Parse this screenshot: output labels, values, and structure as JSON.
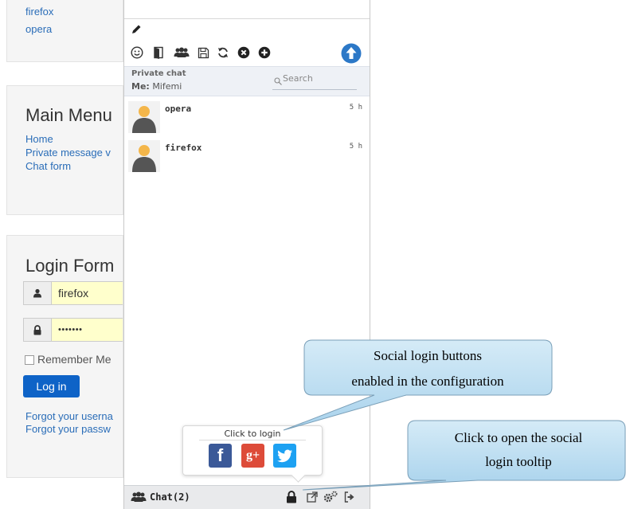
{
  "sidebar_users": {
    "links": [
      "firefox",
      "opera"
    ]
  },
  "main_menu": {
    "title": "Main Menu",
    "links": [
      "Home",
      "Private message v",
      "Chat form"
    ]
  },
  "login_form": {
    "title": "Login Form",
    "username_value": "firefox",
    "password_value": "•••••••",
    "remember_label": "Remember Me",
    "login_button": "Log in",
    "forgot_username": "Forgot your userna",
    "forgot_password": "Forgot your passw"
  },
  "chat": {
    "toolbar_icons": [
      "pencil-icon",
      "smiley-icon",
      "exit-door-icon",
      "users-icon",
      "save-icon",
      "refresh-icon",
      "close-circle-icon",
      "plus-circle-icon",
      "up-arrow-icon"
    ],
    "header_title": "Private chat",
    "me_label": "Me:",
    "me_name": "Mifemi",
    "search_placeholder": "Search",
    "messages": [
      {
        "name": "opera",
        "time": "5 h"
      },
      {
        "name": "firefox",
        "time": "5 h"
      }
    ],
    "bottom_label": "Chat(2)",
    "bottom_icons": [
      "lock-icon",
      "external-link-icon",
      "settings-icon",
      "logout-icon"
    ]
  },
  "tooltip": {
    "title": "Click to login",
    "buttons": [
      "Facebook",
      "Google+",
      "Twitter"
    ]
  },
  "callouts": {
    "social_line1": "Social login buttons",
    "social_line2": "enabled in the configuration",
    "open_line1": "Click to open the social",
    "open_line2": "login tooltip"
  },
  "colors": {
    "link": "#2a6db8",
    "login_button": "#0e63c7",
    "callout_fill_top": "#d5ebf7",
    "callout_fill_bottom": "#a8d2ec",
    "facebook": "#3b5998",
    "googleplus": "#dd4b39",
    "twitter": "#1da1f2",
    "upload_circle": "#2c78c7"
  }
}
